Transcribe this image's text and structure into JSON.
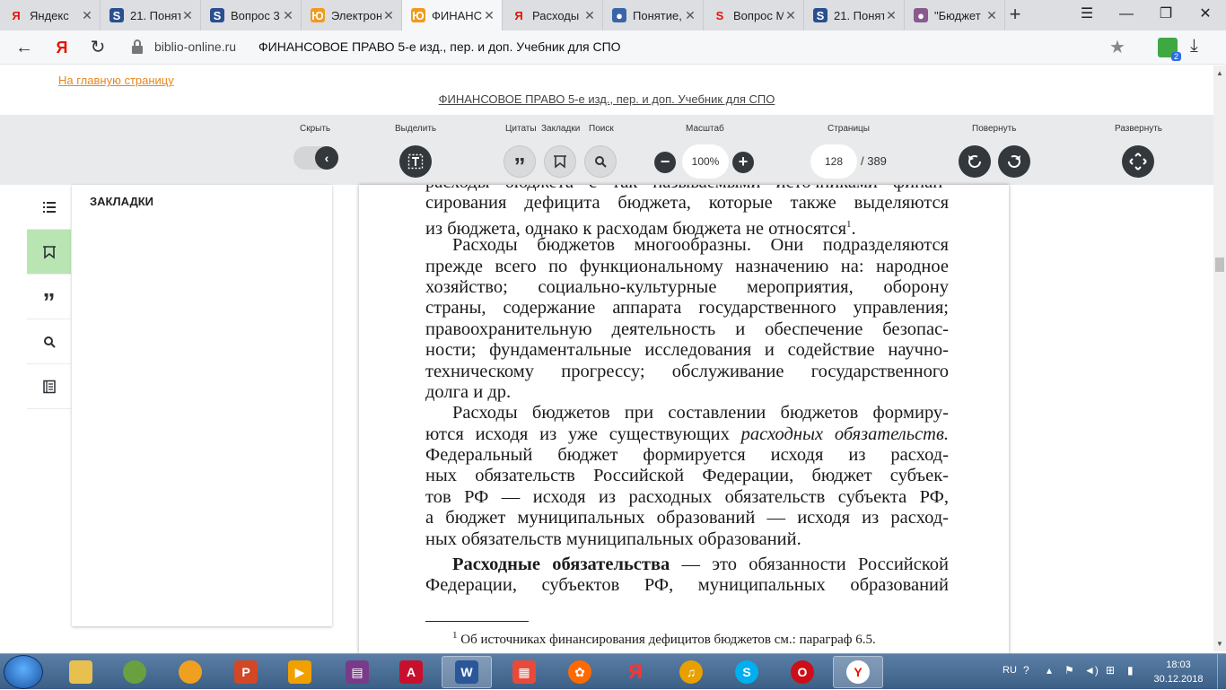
{
  "browser": {
    "tabs": [
      {
        "title": "Яндекс",
        "icon": "yandex-icon"
      },
      {
        "title": "21. Понят",
        "icon": "studfiles-icon"
      },
      {
        "title": "Вопрос 3",
        "icon": "studfiles-icon"
      },
      {
        "title": "Электрон",
        "icon": "urait-icon"
      },
      {
        "title": "ФИНАНС",
        "icon": "urait-icon",
        "active": true
      },
      {
        "title": "Расходы",
        "icon": "yandex-icon"
      },
      {
        "title": "Понятие,",
        "icon": "site-icon"
      },
      {
        "title": "Вопрос М",
        "icon": "s-red-icon"
      },
      {
        "title": "21. Понят",
        "icon": "studfiles-icon"
      },
      {
        "title": "\"Бюджет",
        "icon": "avatar-icon"
      }
    ],
    "address": {
      "domain": "biblio-online.ru",
      "page_title": "ФИНАНСОВОЕ ПРАВО 5-е изд., пер. и доп. Учебник для СПО"
    },
    "extension_badge": "2"
  },
  "site": {
    "home_link": "На главную страницу",
    "book_link": "ФИНАНСОВОЕ ПРАВО 5-е изд., пер. и доп. Учебник для СПО"
  },
  "toolbar": {
    "hide_label": "Скрыть",
    "select_label": "Выделить",
    "quotes_label": "Цитаты",
    "bookmarks_label": "Закладки",
    "search_label": "Поиск",
    "zoom_label": "Масштаб",
    "zoom_value": "100%",
    "pages_label": "Страницы",
    "page_current": "128",
    "page_total": "/ 389",
    "rotate_label": "Повернуть",
    "expand_label": "Развернуть"
  },
  "panel": {
    "title": "ЗАКЛАДКИ"
  },
  "page": {
    "lines": [
      "расходы бюджета с так называемыми источниками финан-",
      "сирования дефицита бюджета, которые также выделяются",
      "из бюджета, однако к расходам бюджета не относятся",
      "Расходы бюджетов многообразны. Они подразделяются",
      "прежде всего по функциональному назначению на: народное",
      "хозяйство; социально-культурные мероприятия, оборону",
      "страны, содержание аппарата государственного управления;",
      "правоохранительную деятельность и обеспечение безопас-",
      "ности; фундаментальные исследования и содействие научно-",
      "техническому прогрессу; обслуживание государственного",
      "долга и др.",
      "Расходы бюджетов при составлении бюджетов формиру-",
      "ются исходя из уже существующих",
      "Федеральный бюджет формируется исходя из расход-",
      "ных обязательств Российской Федерации, бюджет субъек-",
      "тов РФ — исходя из расходных обязательств субъекта РФ,",
      "а бюджет муниципальных образований — исходя из расход-",
      "ных обязательств муниципальных образований.",
      "— это обязанности Российской",
      "Федерации, субъектов РФ, муниципальных образований"
    ],
    "footnote_mark": "1",
    "line3_end": ".",
    "italic_term": "расходных обязательств.",
    "bold_term": "Расходные обязательства",
    "footnote": "Об источниках финансирования дефицитов бюджетов см.: параграф 6.5."
  },
  "taskbar": {
    "lang": "RU",
    "time": "18:03",
    "date": "30.12.2018"
  }
}
